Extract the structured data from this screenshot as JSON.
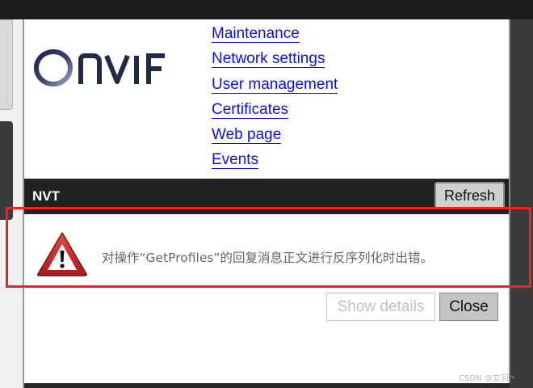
{
  "logo": {
    "brand": "ONVIF",
    "colors": {
      "dark": "#222a4a",
      "light": "#8a94b8"
    }
  },
  "nav": {
    "items": [
      {
        "label": "Maintenance"
      },
      {
        "label": "Network settings"
      },
      {
        "label": "User management"
      },
      {
        "label": "Certificates"
      },
      {
        "label": "Web page"
      },
      {
        "label": "Events"
      }
    ],
    "link_color": "#1010d8"
  },
  "device_bar": {
    "title": "NVT",
    "refresh_label": "Refresh"
  },
  "error_dialog": {
    "icon": "warning-triangle-icon",
    "message": "对操作“GetProfiles”的回复消息正文进行反序列化时出错。",
    "show_details_label": "Show details",
    "close_label": "Close",
    "highlight_color": "#ee2222"
  },
  "watermark": {
    "text": "CSDN @立羽丶"
  }
}
